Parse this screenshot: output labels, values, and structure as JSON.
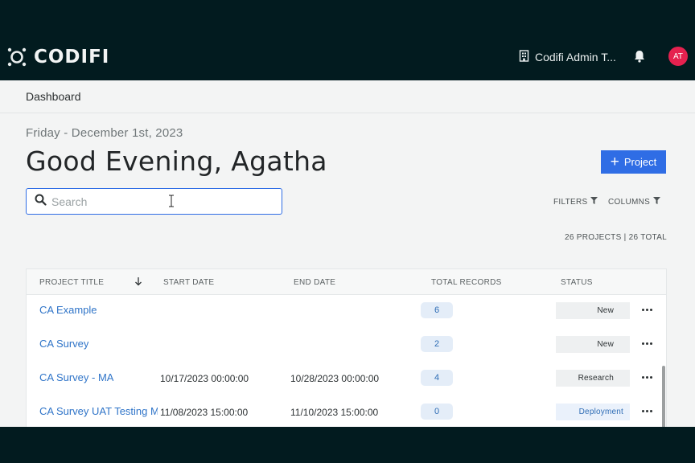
{
  "app": {
    "logo_text": "CODIFI",
    "org_name": "Codifi Admin T...",
    "avatar_initials": "AT",
    "colors": {
      "header_bg": "#021b1f",
      "accent": "#2f6de5",
      "avatar": "#e5214f",
      "link": "#2f74c8"
    }
  },
  "breadcrumb": {
    "label": "Dashboard"
  },
  "header": {
    "date": "Friday - December 1st, 2023",
    "greeting": "Good Evening, Agatha",
    "new_project_label": "Project"
  },
  "search": {
    "placeholder": "Search",
    "value": ""
  },
  "toolbar": {
    "filters_label": "FILTERS",
    "columns_label": "COLUMNS",
    "summary": "26 PROJECTS | 26 TOTAL"
  },
  "table": {
    "columns": {
      "title": "PROJECT TITLE",
      "start": "START DATE",
      "end": "END DATE",
      "records": "TOTAL RECORDS",
      "status": "STATUS"
    },
    "rows": [
      {
        "title": "CA Example",
        "start": "",
        "end": "",
        "records": "6",
        "status": "New"
      },
      {
        "title": "CA Survey",
        "start": "",
        "end": "",
        "records": "2",
        "status": "New"
      },
      {
        "title": "CA Survey - MA",
        "start": "10/17/2023 00:00:00",
        "end": "10/28/2023 00:00:00",
        "records": "4",
        "status": "Research"
      },
      {
        "title": "CA Survey UAT Testing M",
        "start": "11/08/2023 15:00:00",
        "end": "11/10/2023 15:00:00",
        "records": "0",
        "status": "Deployment"
      }
    ]
  }
}
